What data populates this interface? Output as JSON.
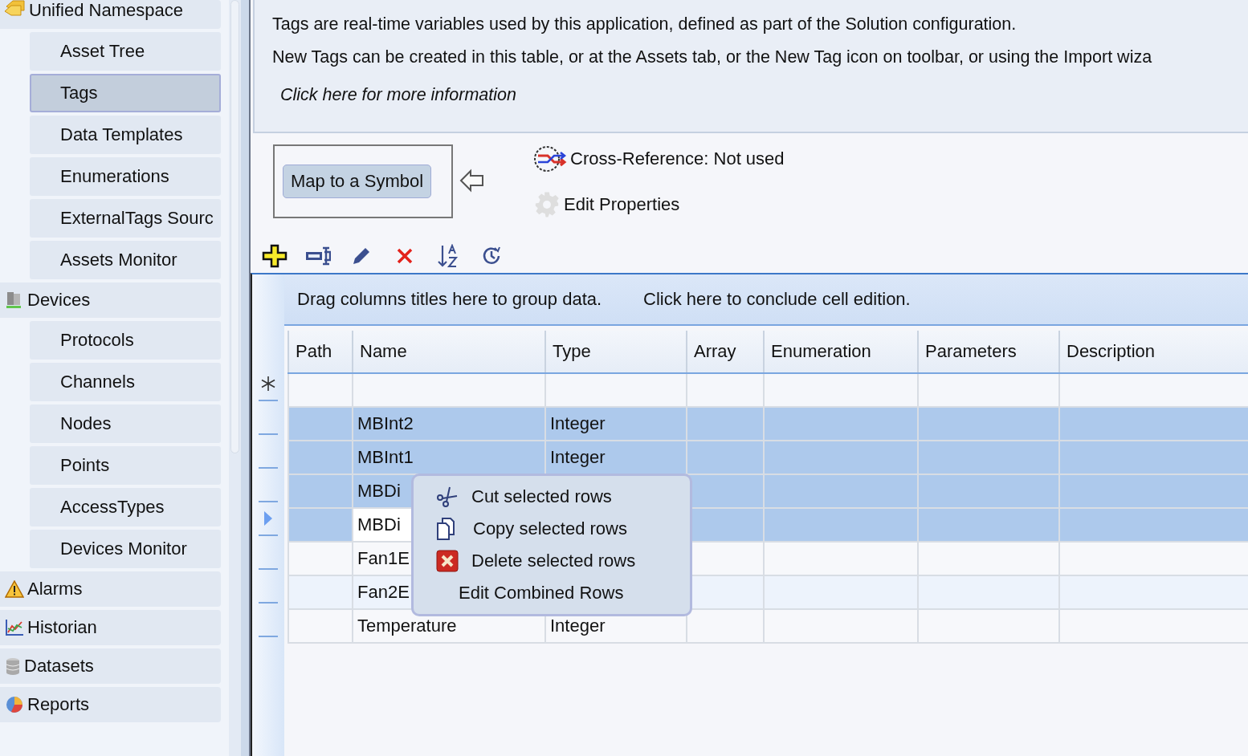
{
  "sidebar": {
    "groups": [
      {
        "label": "Unified Namespace",
        "kind": "namespace",
        "children": [
          {
            "label": "Asset Tree",
            "selected": false
          },
          {
            "label": "Tags",
            "selected": true
          },
          {
            "label": "Data Templates",
            "selected": false
          },
          {
            "label": "Enumerations",
            "selected": false
          },
          {
            "label": "ExternalTags Sourc",
            "selected": false
          },
          {
            "label": "Assets Monitor",
            "selected": false
          }
        ]
      },
      {
        "label": "Devices",
        "kind": "devices",
        "children": [
          {
            "label": "Protocols",
            "selected": false
          },
          {
            "label": "Channels",
            "selected": false
          },
          {
            "label": "Nodes",
            "selected": false
          },
          {
            "label": "Points",
            "selected": false
          },
          {
            "label": "AccessTypes",
            "selected": false
          },
          {
            "label": "Devices Monitor",
            "selected": false
          }
        ]
      },
      {
        "label": "Alarms",
        "kind": "alarms"
      },
      {
        "label": "Historian",
        "kind": "historian"
      },
      {
        "label": "Datasets",
        "kind": "datasets"
      },
      {
        "label": "Reports",
        "kind": "reports"
      }
    ]
  },
  "info": {
    "lines": [
      "Tags are  real-time variables used by this application, defined as part of the Solution configuration.",
      "New Tags can be created in this table, or at the Assets tab, or the New Tag icon on toolbar, or using the Import wiza"
    ],
    "link": "Click here for more information"
  },
  "map_button": "Map to a Symbol",
  "cross_reference": "Cross-Reference: Not used",
  "edit_properties": "Edit Properties",
  "grid": {
    "group_hint": "Drag columns titles here to group data.",
    "conclude_hint": "Click here to conclude cell edition.",
    "columns": [
      "Path",
      "Name",
      "Type",
      "Array",
      "Enumeration",
      "Parameters",
      "Description"
    ],
    "rows": [
      {
        "cells": [
          "",
          "MBInt2",
          "Integer",
          "",
          "",
          "",
          ""
        ],
        "selected": true,
        "current": false
      },
      {
        "cells": [
          "",
          "MBInt1",
          "Integer",
          "",
          "",
          "",
          ""
        ],
        "selected": true,
        "current": false
      },
      {
        "cells": [
          "",
          "MBDi",
          "",
          "",
          "",
          "",
          ""
        ],
        "selected": true,
        "current": false
      },
      {
        "cells": [
          "",
          "MBDi",
          "",
          "",
          "",
          "",
          ""
        ],
        "selected": true,
        "current": true
      },
      {
        "cells": [
          "",
          "Fan1E",
          "",
          "",
          "",
          "",
          ""
        ],
        "selected": false,
        "current": false
      },
      {
        "cells": [
          "",
          "Fan2E",
          "",
          "",
          "",
          "",
          ""
        ],
        "selected": false,
        "current": false
      },
      {
        "cells": [
          "",
          "Temperature",
          "Integer",
          "",
          "",
          "",
          ""
        ],
        "selected": false,
        "current": false
      }
    ]
  },
  "context_menu": {
    "items": [
      {
        "label": "Cut selected rows",
        "kind": "cut"
      },
      {
        "label": "Copy selected rows",
        "kind": "copy"
      },
      {
        "label": "Delete selected rows",
        "kind": "delete"
      },
      {
        "label": "Edit Combined Rows",
        "kind": "plain"
      }
    ]
  }
}
